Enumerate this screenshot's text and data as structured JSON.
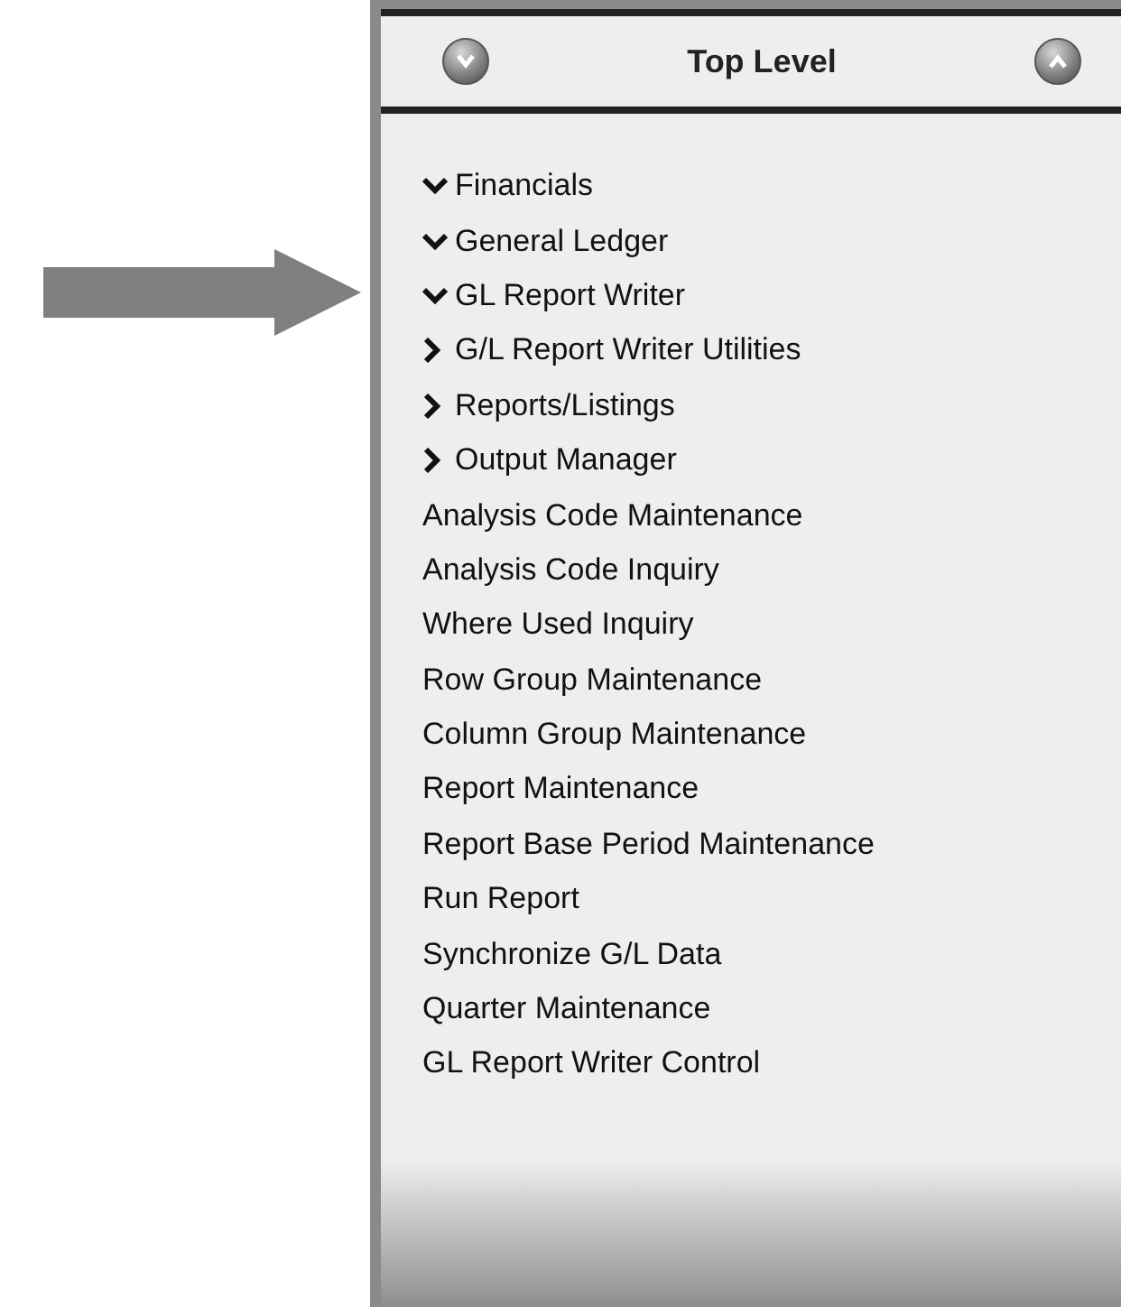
{
  "panel": {
    "title": "Top Level"
  },
  "tree": [
    {
      "label": "Financials",
      "kind": "folder",
      "expanded": true,
      "children": [
        {
          "label": "General Ledger",
          "kind": "folder",
          "expanded": true,
          "children": [
            {
              "label": "GL Report Writer",
              "kind": "folder",
              "expanded": true,
              "children": [
                {
                  "label": "G/L Report Writer Utilities",
                  "kind": "folder",
                  "expanded": false
                },
                {
                  "label": "Reports/Listings",
                  "kind": "folder",
                  "expanded": false
                },
                {
                  "label": "Output Manager",
                  "kind": "folder",
                  "expanded": false
                },
                {
                  "label": "Analysis Code Maintenance",
                  "kind": "item"
                },
                {
                  "label": "Analysis Code Inquiry",
                  "kind": "item"
                },
                {
                  "label": "Where Used Inquiry",
                  "kind": "item"
                },
                {
                  "label": "Row Group Maintenance",
                  "kind": "item"
                },
                {
                  "label": "Column Group Maintenance",
                  "kind": "item"
                },
                {
                  "label": "Report Maintenance",
                  "kind": "item"
                },
                {
                  "label": "Report Base Period Maintenance",
                  "kind": "item"
                },
                {
                  "label": "Run Report",
                  "kind": "item"
                },
                {
                  "label": "Synchronize G/L Data",
                  "kind": "item"
                },
                {
                  "label": "Quarter Maintenance",
                  "kind": "item"
                },
                {
                  "label": "GL Report Writer Control",
                  "kind": "item"
                }
              ]
            }
          ]
        }
      ]
    }
  ]
}
